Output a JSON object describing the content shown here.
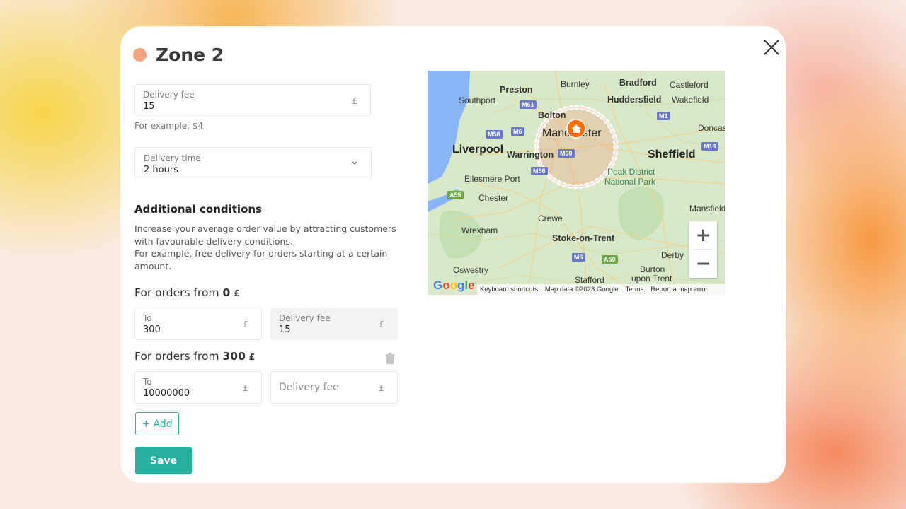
{
  "zone": {
    "title": "Zone 2",
    "dot_color": "#f4a47e"
  },
  "delivery_fee": {
    "label": "Delivery fee",
    "value": "15",
    "currency": "£",
    "hint": "For example, $4"
  },
  "delivery_time": {
    "label": "Delivery time",
    "value": "2 hours"
  },
  "additional": {
    "heading": "Additional conditions",
    "desc_line1": "Increase your average order value by attracting customers with favourable delivery conditions.",
    "desc_line2": "For example, free delivery for orders starting at a certain amount."
  },
  "tiers": [
    {
      "prefix": "For orders from",
      "from": "0",
      "currency": "£",
      "to_label": "To",
      "to_value": "300",
      "fee_label": "Delivery fee",
      "fee_value": "15"
    },
    {
      "prefix": "For orders from",
      "from": "300",
      "currency": "£",
      "to_label": "To",
      "to_value": "10000000",
      "fee_placeholder": "Delivery fee"
    }
  ],
  "buttons": {
    "add": "+ Add",
    "save": "Save"
  },
  "map": {
    "labels": {
      "preston": "Preston",
      "burnley": "Burnley",
      "bradford": "Bradford",
      "castleford": "Castleford",
      "southport": "Southport",
      "huddersfield": "Huddersfield",
      "wakefield": "Wakefield",
      "bolton": "Bolton",
      "manchester": "Manchester",
      "doncaster": "Doncas",
      "liverpool": "Liverpool",
      "warrington": "Warrington",
      "sheffield": "Sheffield",
      "ellesmere": "Ellesmere Port",
      "peak1": "Peak District",
      "peak2": "National Park",
      "chester": "Chester",
      "mansfield": "Mansfield",
      "crewe": "Crewe",
      "wrexham": "Wrexham",
      "stoke": "Stoke-on-Trent",
      "derby": "Derby",
      "oswestry": "Oswestry",
      "burton1": "Burton",
      "burton2": "upon Trent",
      "stafford": "Stafford"
    },
    "roads": {
      "m61": "M61",
      "m1": "M1",
      "m58": "M58",
      "m6a": "M6",
      "m60": "M60",
      "m18": "M18",
      "m56": "M56",
      "a55": "A55",
      "m6b": "M6",
      "a50": "A50"
    },
    "attribution": {
      "shortcuts": "Keyboard shortcuts",
      "data": "Map data ©2023 Google",
      "terms": "Terms",
      "report": "Report a map error"
    },
    "google": "Google"
  }
}
